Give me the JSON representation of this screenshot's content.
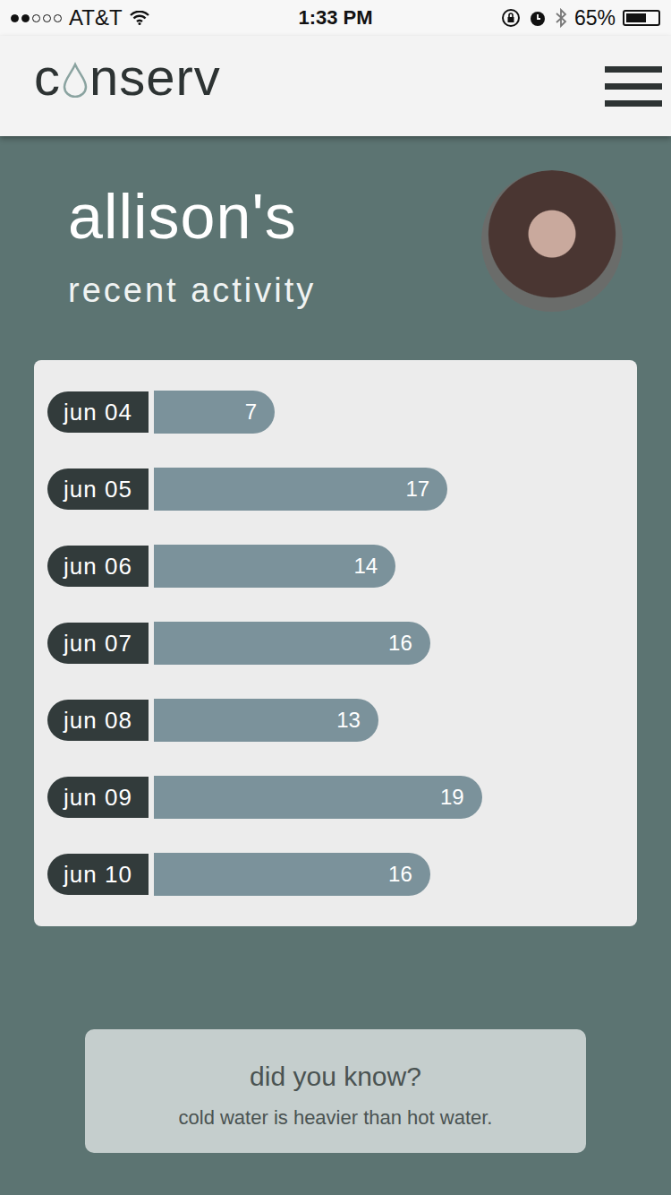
{
  "status_bar": {
    "carrier": "AT&T",
    "signal": {
      "level": 0.4
    },
    "time": "1:33 PM",
    "battery": {
      "reading": "65%",
      "level": 0.65
    }
  },
  "header": {
    "logo": {
      "before": "c",
      "after": "nserv"
    }
  },
  "profile": {
    "title": "allison's",
    "subtitle": "recent activity"
  },
  "chart": {
    "labels": [
      "jun 04",
      "jun 05",
      "jun 06",
      "jun 07",
      "jun 08",
      "jun 09",
      "jun 10"
    ],
    "values": [
      7,
      17,
      14,
      16,
      13,
      19,
      16
    ],
    "value_labels": [
      "7",
      "17",
      "14",
      "16",
      "13",
      "19",
      "16"
    ]
  },
  "tip": {
    "title": "did you know?",
    "text": "cold water is heavier than hot water."
  }
}
